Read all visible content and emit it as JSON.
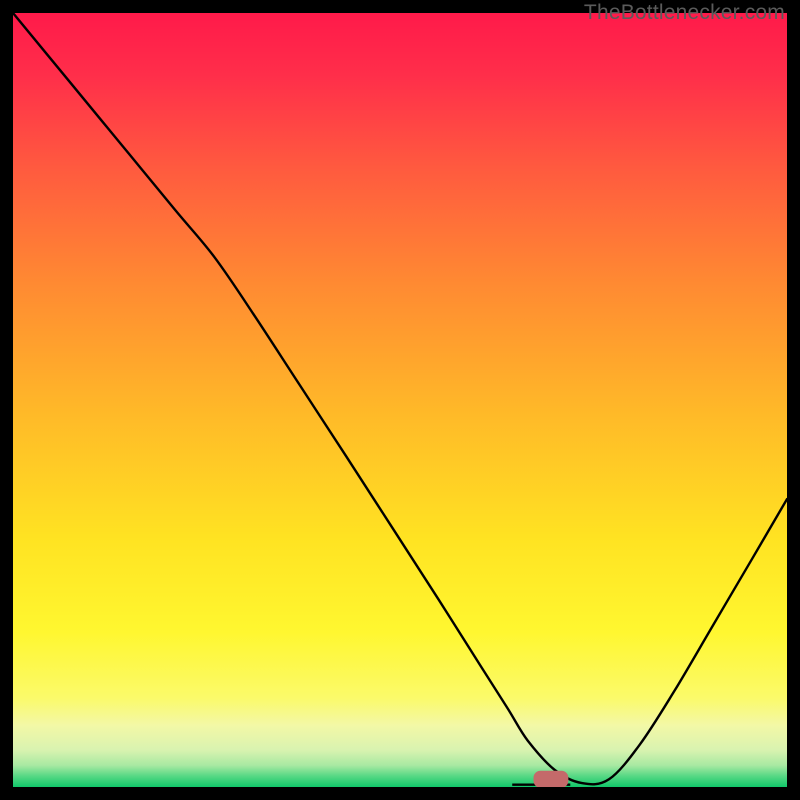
{
  "watermark": "TheBottlenecker.com",
  "chart_data": {
    "type": "line",
    "title": "",
    "xlabel": "",
    "ylabel": "",
    "xlim": [
      0,
      1
    ],
    "ylim": [
      0,
      1
    ],
    "background_gradient_stops": [
      {
        "offset": 0.0,
        "color": "#ff1a4a"
      },
      {
        "offset": 0.08,
        "color": "#ff2e4a"
      },
      {
        "offset": 0.2,
        "color": "#ff5a3f"
      },
      {
        "offset": 0.35,
        "color": "#ff8a32"
      },
      {
        "offset": 0.52,
        "color": "#ffba28"
      },
      {
        "offset": 0.68,
        "color": "#ffe322"
      },
      {
        "offset": 0.8,
        "color": "#fff730"
      },
      {
        "offset": 0.885,
        "color": "#fbfa6a"
      },
      {
        "offset": 0.92,
        "color": "#f3f8a6"
      },
      {
        "offset": 0.952,
        "color": "#d9f3b0"
      },
      {
        "offset": 0.972,
        "color": "#a8e9a2"
      },
      {
        "offset": 0.986,
        "color": "#56d884"
      },
      {
        "offset": 1.0,
        "color": "#11c76a"
      }
    ],
    "series": [
      {
        "name": "bottleneck-curve",
        "x": [
          0.0,
          0.07,
          0.14,
          0.21,
          0.26,
          0.31,
          0.37,
          0.43,
          0.49,
          0.55,
          0.605,
          0.64,
          0.665,
          0.7,
          0.735,
          0.77,
          0.81,
          0.855,
          0.905,
          0.955,
          1.0
        ],
        "y": [
          1.0,
          0.915,
          0.83,
          0.745,
          0.685,
          0.612,
          0.52,
          0.428,
          0.335,
          0.242,
          0.155,
          0.1,
          0.06,
          0.022,
          0.005,
          0.01,
          0.055,
          0.125,
          0.21,
          0.295,
          0.372
        ]
      }
    ],
    "flat_segment": {
      "x0": 0.645,
      "x1": 0.72,
      "y": 0.003
    },
    "marker": {
      "cx": 0.695,
      "cy": 0.01,
      "w": 0.045,
      "h": 0.022,
      "color": "#c46a6a"
    }
  }
}
